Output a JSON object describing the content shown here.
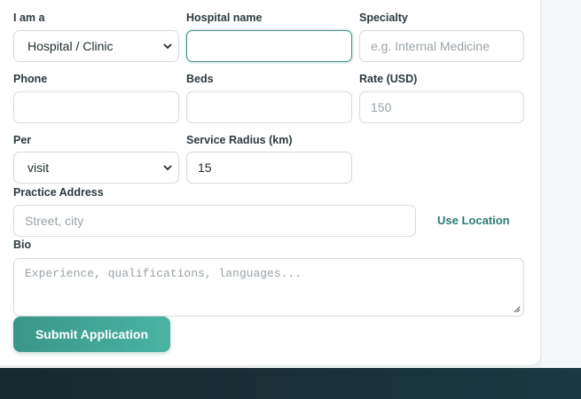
{
  "form": {
    "role_label": "I am a",
    "role_value": "Hospital / Clinic",
    "hospital_name_label": "Hospital name",
    "hospital_name_value": "",
    "specialty_label": "Specialty",
    "specialty_placeholder": "e.g. Internal Medicine",
    "phone_label": "Phone",
    "phone_value": "",
    "beds_label": "Beds",
    "beds_value": "",
    "rate_label": "Rate (USD)",
    "rate_placeholder": "150",
    "per_label": "Per",
    "per_value": "visit",
    "radius_label": "Service Radius (km)",
    "radius_value": "15",
    "address_label": "Practice Address",
    "address_placeholder": "Street, city",
    "use_location_label": "Use Location",
    "bio_label": "Bio",
    "bio_placeholder": "Experience, qualifications, languages...",
    "submit_label": "Submit Application"
  },
  "icons": {
    "select_arrow": "chevron-down-icon",
    "resize": "resize-grip-icon"
  },
  "colors": {
    "accent": "#3a9688",
    "link": "#2c7a74",
    "footer": "#17282f"
  }
}
